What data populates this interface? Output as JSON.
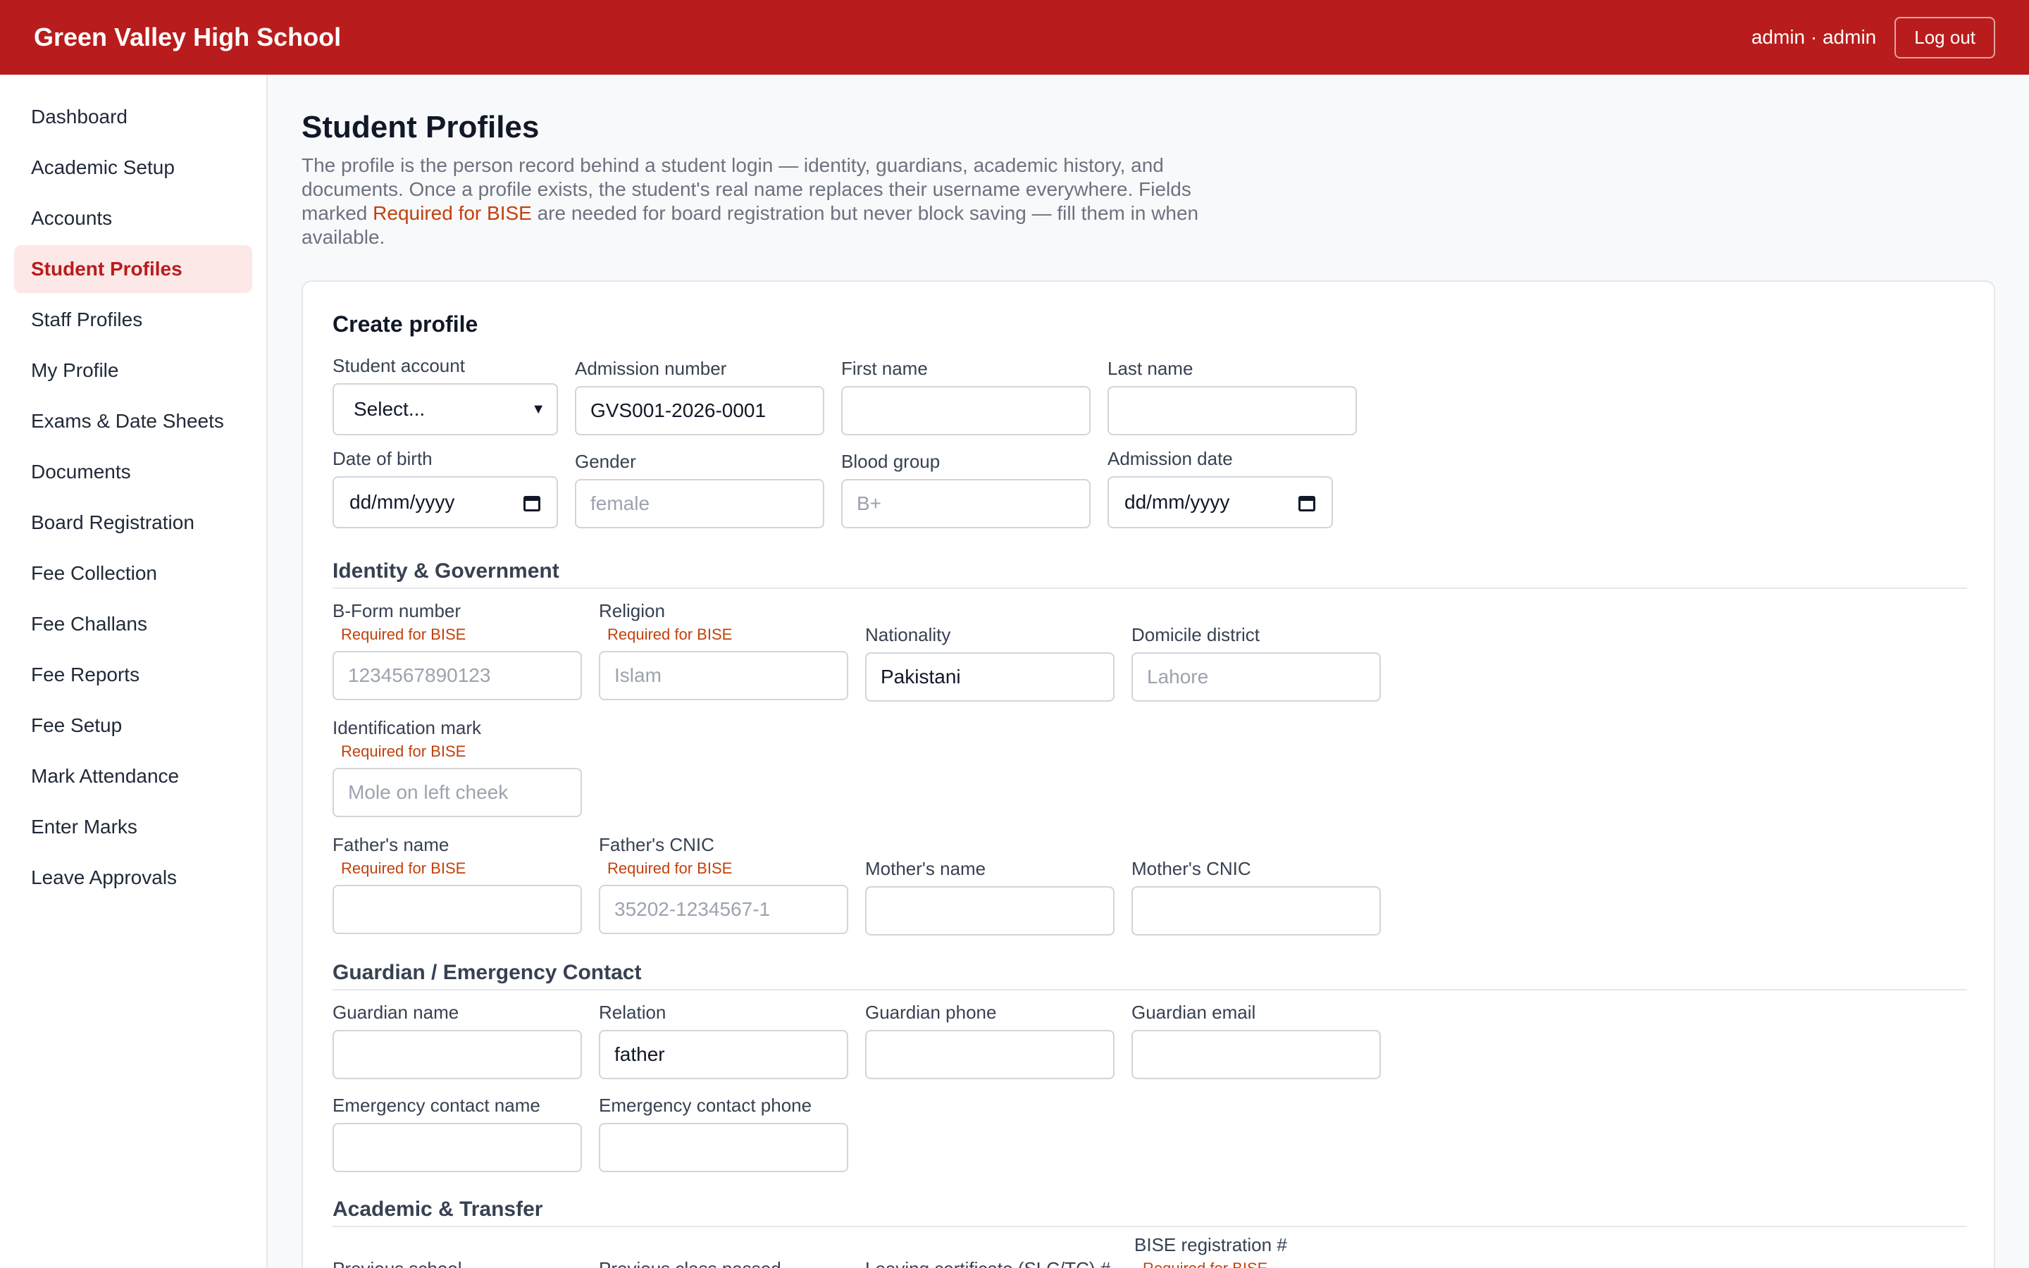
{
  "header": {
    "brand": "Green Valley High School",
    "user": "admin · admin",
    "logout": "Log out",
    "color": "#b91c1c"
  },
  "sidebar": {
    "items": [
      {
        "label": "Dashboard"
      },
      {
        "label": "Academic Setup"
      },
      {
        "label": "Accounts"
      },
      {
        "label": "Student Profiles",
        "active": true
      },
      {
        "label": "Staff Profiles"
      },
      {
        "label": "My Profile"
      },
      {
        "label": "Exams & Date Sheets"
      },
      {
        "label": "Documents"
      },
      {
        "label": "Board Registration"
      },
      {
        "label": "Fee Collection"
      },
      {
        "label": "Fee Challans"
      },
      {
        "label": "Fee Reports"
      },
      {
        "label": "Fee Setup"
      },
      {
        "label": "Mark Attendance"
      },
      {
        "label": "Enter Marks"
      },
      {
        "label": "Leave Approvals"
      }
    ]
  },
  "page": {
    "title": "Student Profiles",
    "intro_before": "The profile is the person record behind a student login — identity, guardians, academic history, and documents. Once a profile exists, the student's real name replaces their username everywhere. Fields marked ",
    "intro_highlight": "Required for BISE",
    "intro_after": " are needed for board registration but never block saving — fill them in when available."
  },
  "form": {
    "title": "Create profile",
    "bise_label": "Required for BISE",
    "basic": {
      "student_account": {
        "label": "Student account",
        "value": "Select..."
      },
      "admission_number": {
        "label": "Admission number",
        "value": "GVS001-2026-0001"
      },
      "first_name": {
        "label": "First name",
        "value": ""
      },
      "last_name": {
        "label": "Last name",
        "value": ""
      },
      "dob": {
        "label": "Date of birth",
        "value": "dd/mm/yyyy"
      },
      "gender": {
        "label": "Gender",
        "placeholder": "female"
      },
      "blood_group": {
        "label": "Blood group",
        "placeholder": "B+"
      },
      "admission_date": {
        "label": "Admission date",
        "value": "dd/mm/yyyy"
      }
    },
    "identity": {
      "title": "Identity & Government",
      "bform": {
        "label": "B-Form number",
        "placeholder": "1234567890123"
      },
      "religion": {
        "label": "Religion",
        "placeholder": "Islam"
      },
      "nationality": {
        "label": "Nationality",
        "value": "Pakistani"
      },
      "domicile": {
        "label": "Domicile district",
        "placeholder": "Lahore"
      },
      "id_mark": {
        "label": "Identification mark",
        "placeholder": "Mole on left cheek"
      },
      "father_name": {
        "label": "Father's name",
        "value": ""
      },
      "father_cnic": {
        "label": "Father's CNIC",
        "placeholder": "35202-1234567-1"
      },
      "mother_name": {
        "label": "Mother's name",
        "value": ""
      },
      "mother_cnic": {
        "label": "Mother's CNIC",
        "value": ""
      }
    },
    "guardian": {
      "title": "Guardian / Emergency Contact",
      "guardian_name": {
        "label": "Guardian name",
        "value": ""
      },
      "relation": {
        "label": "Relation",
        "value": "father"
      },
      "guardian_phone": {
        "label": "Guardian phone",
        "value": ""
      },
      "guardian_email": {
        "label": "Guardian email",
        "value": ""
      },
      "emergency_name": {
        "label": "Emergency contact name",
        "value": ""
      },
      "emergency_phone": {
        "label": "Emergency contact phone",
        "value": ""
      }
    },
    "academic": {
      "title": "Academic & Transfer",
      "previous_school": {
        "label": "Previous school"
      },
      "previous_class": {
        "label": "Previous class passed"
      },
      "leaving_cert": {
        "label": "Leaving certificate (SLC/TC) #"
      },
      "bise_reg": {
        "label": "BISE registration #"
      }
    }
  }
}
